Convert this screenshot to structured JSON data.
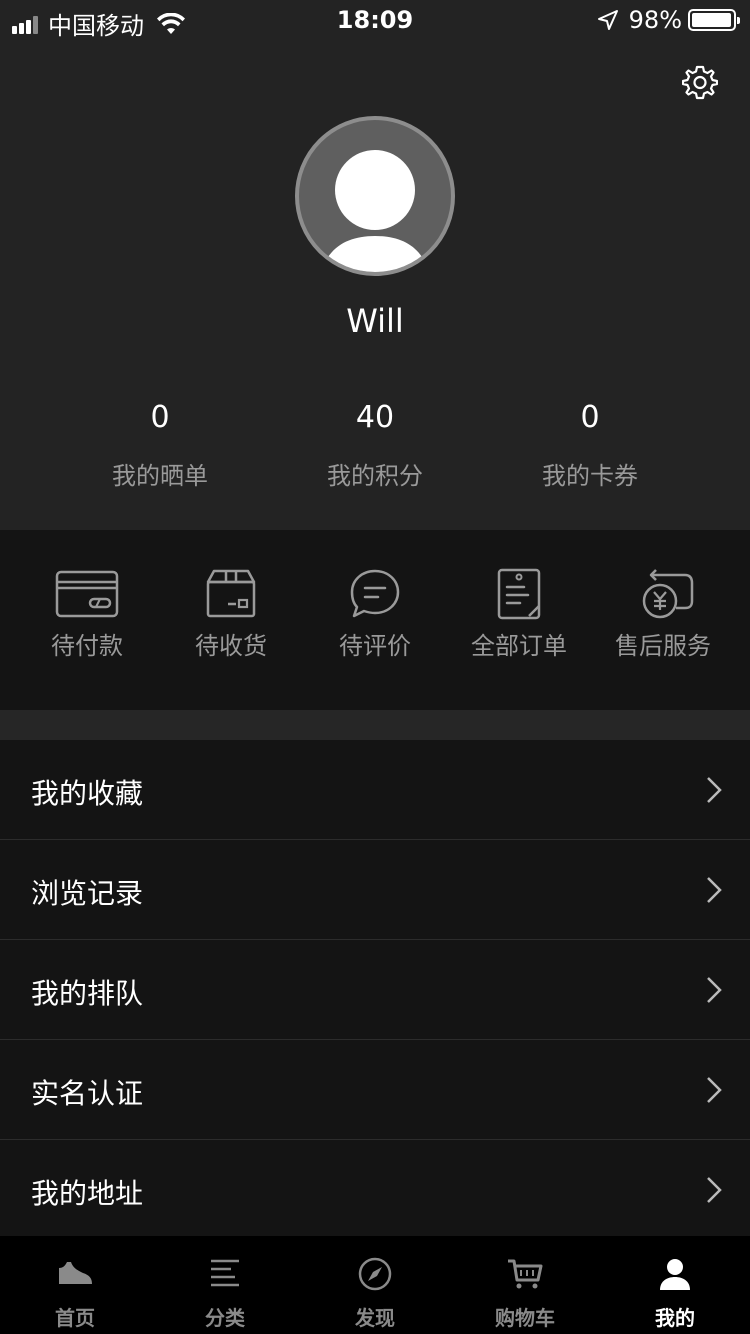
{
  "status_bar": {
    "carrier": "中国移动",
    "time": "18:09",
    "battery": "98%",
    "battery_level": 0.98
  },
  "profile": {
    "username": "Will"
  },
  "stats": [
    {
      "value": "0",
      "label": "我的晒单"
    },
    {
      "value": "40",
      "label": "我的积分"
    },
    {
      "value": "0",
      "label": "我的卡券"
    }
  ],
  "orders": [
    {
      "label": "待付款",
      "icon": "card-icon"
    },
    {
      "label": "待收货",
      "icon": "box-icon"
    },
    {
      "label": "待评价",
      "icon": "comment-icon"
    },
    {
      "label": "全部订单",
      "icon": "order-list-icon"
    },
    {
      "label": "售后服务",
      "icon": "refund-icon"
    }
  ],
  "menu": [
    {
      "label": "我的收藏"
    },
    {
      "label": "浏览记录"
    },
    {
      "label": "我的排队"
    },
    {
      "label": "实名认证"
    },
    {
      "label": "我的地址"
    }
  ],
  "tabbar": {
    "items": [
      {
        "label": "首页",
        "icon": "sneaker-icon"
      },
      {
        "label": "分类",
        "icon": "list-icon"
      },
      {
        "label": "发现",
        "icon": "compass-icon"
      },
      {
        "label": "购物车",
        "icon": "cart-icon"
      },
      {
        "label": "我的",
        "icon": "user-icon"
      }
    ],
    "active_index": 4
  },
  "colors": {
    "header_bg": "#232323",
    "page_bg": "#141414",
    "muted_text": "#9a9a9a",
    "tab_inactive": "#8a8a8a"
  }
}
